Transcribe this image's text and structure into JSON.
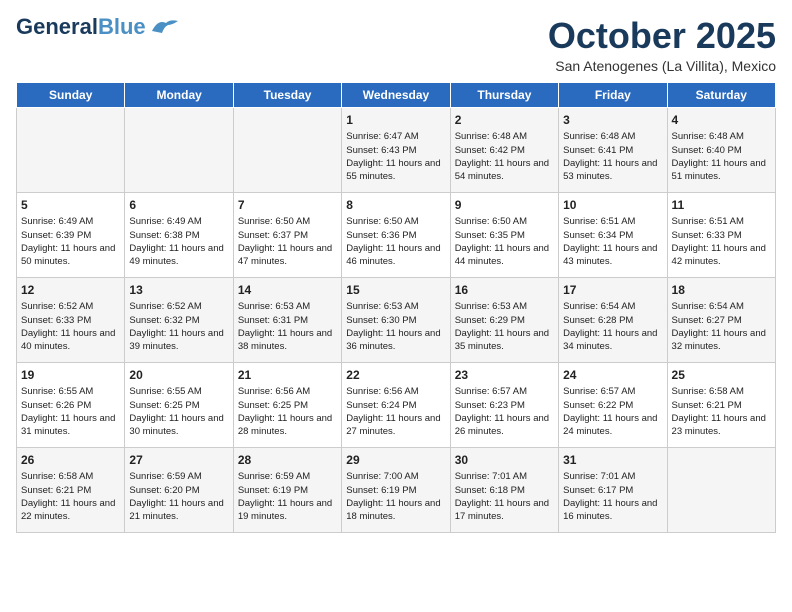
{
  "header": {
    "logo_general": "General",
    "logo_blue": "Blue",
    "month_title": "October 2025",
    "subtitle": "San Atenogenes (La Villita), Mexico"
  },
  "days_of_week": [
    "Sunday",
    "Monday",
    "Tuesday",
    "Wednesday",
    "Thursday",
    "Friday",
    "Saturday"
  ],
  "weeks": [
    [
      {
        "day": "",
        "info": ""
      },
      {
        "day": "",
        "info": ""
      },
      {
        "day": "",
        "info": ""
      },
      {
        "day": "1",
        "info": "Sunrise: 6:47 AM\nSunset: 6:43 PM\nDaylight: 11 hours and 55 minutes."
      },
      {
        "day": "2",
        "info": "Sunrise: 6:48 AM\nSunset: 6:42 PM\nDaylight: 11 hours and 54 minutes."
      },
      {
        "day": "3",
        "info": "Sunrise: 6:48 AM\nSunset: 6:41 PM\nDaylight: 11 hours and 53 minutes."
      },
      {
        "day": "4",
        "info": "Sunrise: 6:48 AM\nSunset: 6:40 PM\nDaylight: 11 hours and 51 minutes."
      }
    ],
    [
      {
        "day": "5",
        "info": "Sunrise: 6:49 AM\nSunset: 6:39 PM\nDaylight: 11 hours and 50 minutes."
      },
      {
        "day": "6",
        "info": "Sunrise: 6:49 AM\nSunset: 6:38 PM\nDaylight: 11 hours and 49 minutes."
      },
      {
        "day": "7",
        "info": "Sunrise: 6:50 AM\nSunset: 6:37 PM\nDaylight: 11 hours and 47 minutes."
      },
      {
        "day": "8",
        "info": "Sunrise: 6:50 AM\nSunset: 6:36 PM\nDaylight: 11 hours and 46 minutes."
      },
      {
        "day": "9",
        "info": "Sunrise: 6:50 AM\nSunset: 6:35 PM\nDaylight: 11 hours and 44 minutes."
      },
      {
        "day": "10",
        "info": "Sunrise: 6:51 AM\nSunset: 6:34 PM\nDaylight: 11 hours and 43 minutes."
      },
      {
        "day": "11",
        "info": "Sunrise: 6:51 AM\nSunset: 6:33 PM\nDaylight: 11 hours and 42 minutes."
      }
    ],
    [
      {
        "day": "12",
        "info": "Sunrise: 6:52 AM\nSunset: 6:33 PM\nDaylight: 11 hours and 40 minutes."
      },
      {
        "day": "13",
        "info": "Sunrise: 6:52 AM\nSunset: 6:32 PM\nDaylight: 11 hours and 39 minutes."
      },
      {
        "day": "14",
        "info": "Sunrise: 6:53 AM\nSunset: 6:31 PM\nDaylight: 11 hours and 38 minutes."
      },
      {
        "day": "15",
        "info": "Sunrise: 6:53 AM\nSunset: 6:30 PM\nDaylight: 11 hours and 36 minutes."
      },
      {
        "day": "16",
        "info": "Sunrise: 6:53 AM\nSunset: 6:29 PM\nDaylight: 11 hours and 35 minutes."
      },
      {
        "day": "17",
        "info": "Sunrise: 6:54 AM\nSunset: 6:28 PM\nDaylight: 11 hours and 34 minutes."
      },
      {
        "day": "18",
        "info": "Sunrise: 6:54 AM\nSunset: 6:27 PM\nDaylight: 11 hours and 32 minutes."
      }
    ],
    [
      {
        "day": "19",
        "info": "Sunrise: 6:55 AM\nSunset: 6:26 PM\nDaylight: 11 hours and 31 minutes."
      },
      {
        "day": "20",
        "info": "Sunrise: 6:55 AM\nSunset: 6:25 PM\nDaylight: 11 hours and 30 minutes."
      },
      {
        "day": "21",
        "info": "Sunrise: 6:56 AM\nSunset: 6:25 PM\nDaylight: 11 hours and 28 minutes."
      },
      {
        "day": "22",
        "info": "Sunrise: 6:56 AM\nSunset: 6:24 PM\nDaylight: 11 hours and 27 minutes."
      },
      {
        "day": "23",
        "info": "Sunrise: 6:57 AM\nSunset: 6:23 PM\nDaylight: 11 hours and 26 minutes."
      },
      {
        "day": "24",
        "info": "Sunrise: 6:57 AM\nSunset: 6:22 PM\nDaylight: 11 hours and 24 minutes."
      },
      {
        "day": "25",
        "info": "Sunrise: 6:58 AM\nSunset: 6:21 PM\nDaylight: 11 hours and 23 minutes."
      }
    ],
    [
      {
        "day": "26",
        "info": "Sunrise: 6:58 AM\nSunset: 6:21 PM\nDaylight: 11 hours and 22 minutes."
      },
      {
        "day": "27",
        "info": "Sunrise: 6:59 AM\nSunset: 6:20 PM\nDaylight: 11 hours and 21 minutes."
      },
      {
        "day": "28",
        "info": "Sunrise: 6:59 AM\nSunset: 6:19 PM\nDaylight: 11 hours and 19 minutes."
      },
      {
        "day": "29",
        "info": "Sunrise: 7:00 AM\nSunset: 6:19 PM\nDaylight: 11 hours and 18 minutes."
      },
      {
        "day": "30",
        "info": "Sunrise: 7:01 AM\nSunset: 6:18 PM\nDaylight: 11 hours and 17 minutes."
      },
      {
        "day": "31",
        "info": "Sunrise: 7:01 AM\nSunset: 6:17 PM\nDaylight: 11 hours and 16 minutes."
      },
      {
        "day": "",
        "info": ""
      }
    ]
  ]
}
